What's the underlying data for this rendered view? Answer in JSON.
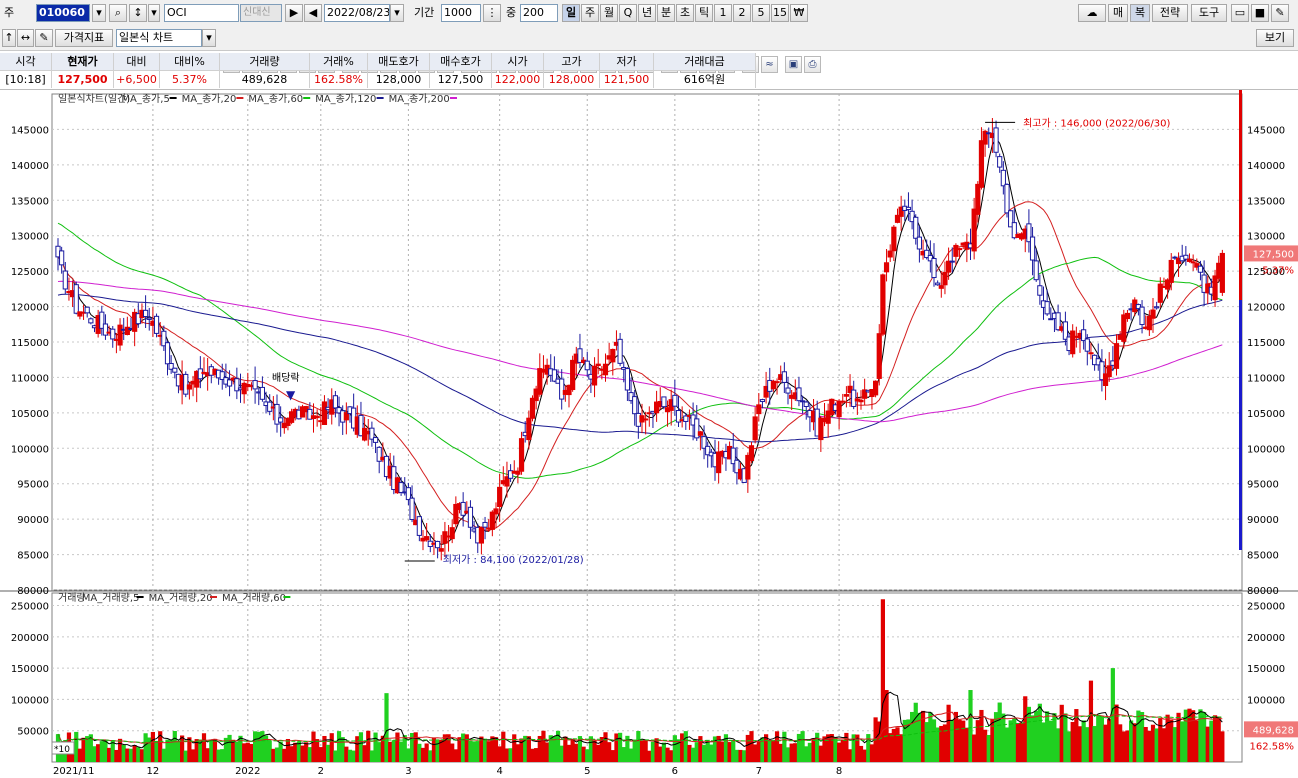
{
  "toolbar": {
    "code_label": "주",
    "stock_code": "010060",
    "stock_name": "OCI",
    "badge": "신대신",
    "date": "2022/08/23",
    "period_label": "기간",
    "period_value": "1000",
    "mid_label": "중",
    "mid_value": "200",
    "timeframes": [
      "일",
      "주",
      "월",
      "Q",
      "년",
      "분",
      "초",
      "틱",
      "1",
      "2",
      "5",
      "15",
      "₩"
    ],
    "right_buttons": [
      "매",
      "복",
      "전략",
      "도구"
    ],
    "indicator_button": "가격지표",
    "chart_type": "일본식 차트",
    "view_button": "보기"
  },
  "quote": {
    "headers": [
      "시각",
      "현재가",
      "대비",
      "대비%",
      "거래량",
      "거래%",
      "매도호가",
      "매수호가",
      "시가",
      "고가",
      "저가",
      "거래대금"
    ],
    "values": [
      "[10:18]",
      "127,500",
      "+6,500",
      "5.37%",
      "489,628",
      "162.58%",
      "128,000",
      "127,500",
      "122,000",
      "128,000",
      "121,500",
      "616억원"
    ]
  },
  "legend": {
    "price": [
      "일본식차트(일간)",
      "MA_종가,5",
      "MA_종가,20",
      "MA_종가,60",
      "MA_종가,120",
      "MA_종가,200"
    ],
    "volume": [
      "거래량",
      "MA_거래량,5",
      "MA_거래량,20",
      "MA_거래량,60"
    ]
  },
  "annotations": {
    "high": "최고가 : 146,000 (2022/06/30)",
    "low": "최저가 : 84,100 (2022/01/28)",
    "dividend": "배당락",
    "price_tag": "127,500",
    "price_pct": "5.37%",
    "vol_tag": "489,628",
    "vol_pct": "162.58%",
    "vol_unit": "*10"
  },
  "colors": {
    "up": "#e10000",
    "down": "#1a1aa0",
    "ma5": "#000000",
    "ma20": "#d42020",
    "ma60": "#10c010",
    "ma120": "#1a1a90",
    "ma200": "#d020d0",
    "vol_up": "#e10000",
    "vol_down": "#20d020"
  },
  "chart_data": {
    "type": "candlestick",
    "x_ticks": [
      "2021/11",
      "12",
      "2022",
      "2",
      "3",
      "4",
      "5",
      "6",
      "7",
      "8"
    ],
    "price_ticks": [
      145000,
      140000,
      135000,
      130000,
      125000,
      120000,
      115000,
      110000,
      105000,
      100000,
      95000,
      90000,
      85000,
      80000
    ],
    "price_range": [
      80000,
      150000
    ],
    "volume_ticks": [
      250000,
      200000,
      150000,
      100000,
      50000
    ],
    "volume_range": [
      0,
      270000
    ],
    "price_path": [
      [
        0,
        126000
      ],
      [
        5,
        120000
      ],
      [
        10,
        118000
      ],
      [
        15,
        116000
      ],
      [
        20,
        118000
      ],
      [
        25,
        119000
      ],
      [
        30,
        113000
      ],
      [
        35,
        108000
      ],
      [
        40,
        111000
      ],
      [
        45,
        110000
      ],
      [
        50,
        109000
      ],
      [
        55,
        107000
      ],
      [
        60,
        104000
      ],
      [
        65,
        105000
      ],
      [
        70,
        104500
      ],
      [
        75,
        106000
      ],
      [
        80,
        104000
      ],
      [
        85,
        102000
      ],
      [
        90,
        97000
      ],
      [
        95,
        93000
      ],
      [
        100,
        88000
      ],
      [
        105,
        86500
      ],
      [
        110,
        92000
      ],
      [
        112,
        91500
      ],
      [
        115,
        87000
      ],
      [
        118,
        89000
      ],
      [
        122,
        95000
      ],
      [
        126,
        98000
      ],
      [
        130,
        108000
      ],
      [
        134,
        112000
      ],
      [
        138,
        107000
      ],
      [
        142,
        113000
      ],
      [
        146,
        110000
      ],
      [
        150,
        112000
      ],
      [
        153,
        114000
      ],
      [
        157,
        106000
      ],
      [
        160,
        103500
      ],
      [
        164,
        106000
      ],
      [
        168,
        106000
      ],
      [
        172,
        104000
      ],
      [
        176,
        102000
      ],
      [
        180,
        98000
      ],
      [
        184,
        99000
      ],
      [
        188,
        96000
      ],
      [
        192,
        106000
      ],
      [
        196,
        110000
      ],
      [
        200,
        109000
      ],
      [
        204,
        107000
      ],
      [
        208,
        103000
      ],
      [
        212,
        106000
      ],
      [
        216,
        108000
      ],
      [
        220,
        106000
      ],
      [
        224,
        110000
      ],
      [
        226,
        124000
      ],
      [
        229,
        131000
      ],
      [
        232,
        134000
      ],
      [
        235,
        130000
      ],
      [
        238,
        128000
      ],
      [
        241,
        122000
      ],
      [
        244,
        127000
      ],
      [
        247,
        128000
      ],
      [
        250,
        129000
      ],
      [
        253,
        143000
      ],
      [
        256,
        145000
      ],
      [
        259,
        137000
      ],
      [
        262,
        129000
      ],
      [
        265,
        131000
      ],
      [
        268,
        125000
      ],
      [
        271,
        118000
      ],
      [
        274,
        117000
      ],
      [
        277,
        115000
      ],
      [
        280,
        117000
      ],
      [
        283,
        114000
      ],
      [
        286,
        109000
      ],
      [
        289,
        113000
      ],
      [
        292,
        119000
      ],
      [
        295,
        121000
      ],
      [
        298,
        117000
      ],
      [
        301,
        121000
      ],
      [
        304,
        124000
      ],
      [
        307,
        128000
      ],
      [
        310,
        127000
      ],
      [
        313,
        124000
      ],
      [
        316,
        121000
      ],
      [
        319,
        127500
      ]
    ],
    "volume_spikes": [
      [
        90,
        110000
      ],
      [
        226,
        260000
      ],
      [
        227,
        115000
      ],
      [
        250,
        115000
      ],
      [
        258,
        95000
      ],
      [
        265,
        105000
      ],
      [
        283,
        130000
      ],
      [
        289,
        150000
      ]
    ],
    "series": [
      {
        "name": "MA_종가,5"
      },
      {
        "name": "MA_종가,20"
      },
      {
        "name": "MA_종가,60"
      },
      {
        "name": "MA_종가,120"
      },
      {
        "name": "MA_종가,200"
      }
    ]
  }
}
